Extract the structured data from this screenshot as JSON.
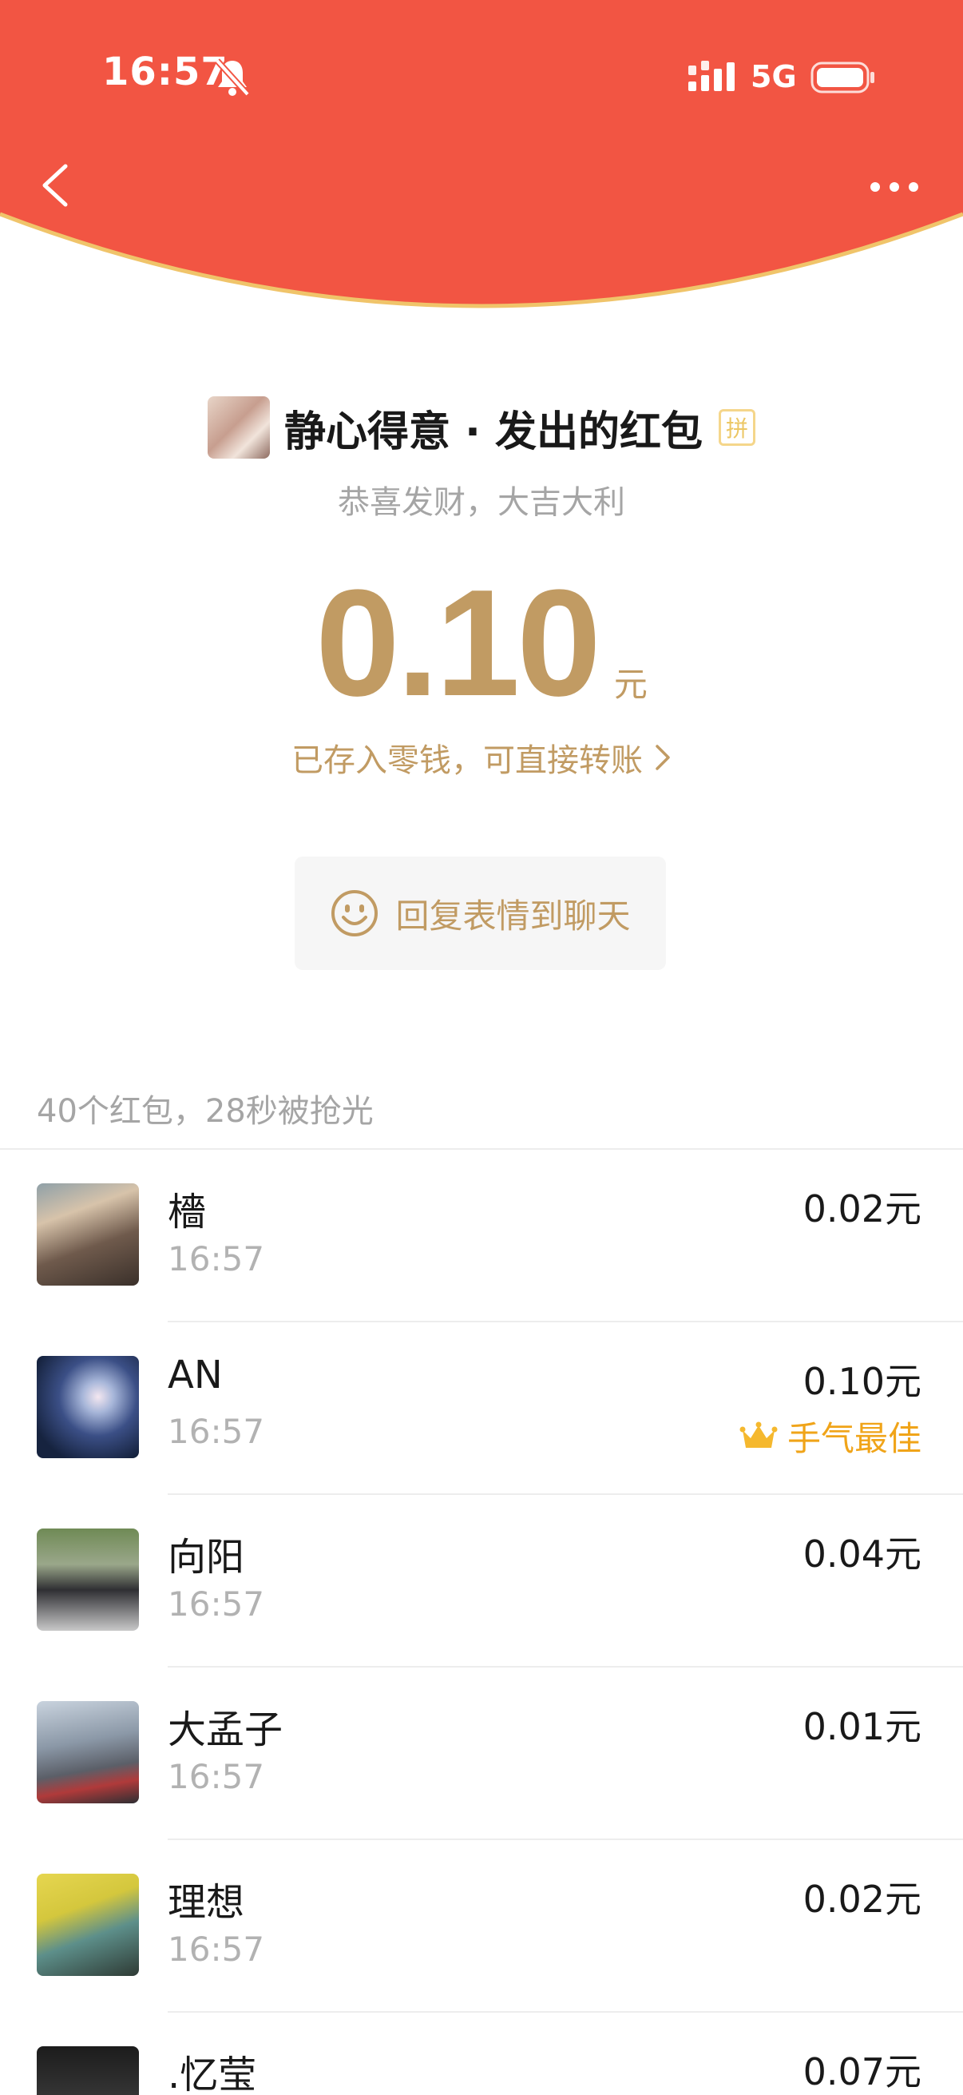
{
  "status_bar": {
    "time": "16:57",
    "network": "5G"
  },
  "colors": {
    "header_red": "#f25543",
    "gold": "#c19b63",
    "best_luck": "#f0a419"
  },
  "icons": [
    "back-icon",
    "more-icon",
    "bell-off-icon",
    "signal-icon",
    "battery-icon",
    "smile-icon",
    "crown-icon",
    "chevron-right-icon"
  ],
  "packet": {
    "sender_title": "静心得意 · 发出的红包",
    "pin_badge": "拼",
    "greeting": "恭喜发财，大吉大利",
    "amount": "0.10",
    "unit": "元",
    "wallet_note": "已存入零钱，可直接转账",
    "reply_button": "回复表情到聊天",
    "summary": "40个红包，28秒被抢光"
  },
  "list": [
    {
      "name": "檣",
      "time": "16:57",
      "amount": "0.02元",
      "best": ""
    },
    {
      "name": "AN",
      "time": "16:57",
      "amount": "0.10元",
      "best": "手气最佳"
    },
    {
      "name": "向阳",
      "time": "16:57",
      "amount": "0.04元",
      "best": ""
    },
    {
      "name": "大孟子",
      "time": "16:57",
      "amount": "0.01元",
      "best": ""
    },
    {
      "name": "理想",
      "time": "16:57",
      "amount": "0.02元",
      "best": ""
    },
    {
      "name": ".忆莹",
      "time": "",
      "amount": "0.07元",
      "best": ""
    }
  ]
}
